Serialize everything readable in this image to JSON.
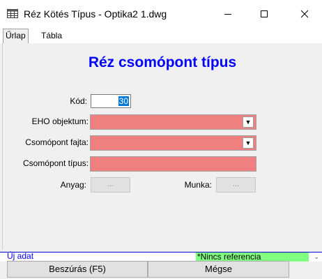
{
  "window": {
    "title": "Réz Kötés Típus - Optika2 1.dwg",
    "minimize_glyph": "—",
    "close_glyph": "✕"
  },
  "tabs": [
    {
      "label": "Űrlap",
      "active": true
    },
    {
      "label": "Tábla",
      "active": false
    }
  ],
  "form": {
    "title": "Réz csomópont típus",
    "kod_label": "Kód:",
    "kod_value": "30",
    "eho_label": "EHO objektum:",
    "eho_value": "",
    "fajta_label": "Csomópont fajta:",
    "fajta_value": "",
    "tipus_label": "Csomópont típus:",
    "tipus_value": "",
    "anyag_label": "Anyag:",
    "anyag_button": "...",
    "munka_label": "Munka:",
    "munka_button": "...",
    "combo_arrow": "▼"
  },
  "status": {
    "left": "Új adat",
    "reference": "*Nincs referencia",
    "chevron": "⌄"
  },
  "buttons": {
    "insert": "Beszúrás (F5)",
    "cancel": "Mégse"
  },
  "colors": {
    "title": "#0000ff",
    "required_field": "#f08080",
    "reference_bg": "#80ff80",
    "selection": "#0078d7"
  },
  "icons": {
    "app": "table-icon",
    "minimize": "minimize-icon",
    "maximize": "maximize-icon",
    "close": "close-icon"
  }
}
